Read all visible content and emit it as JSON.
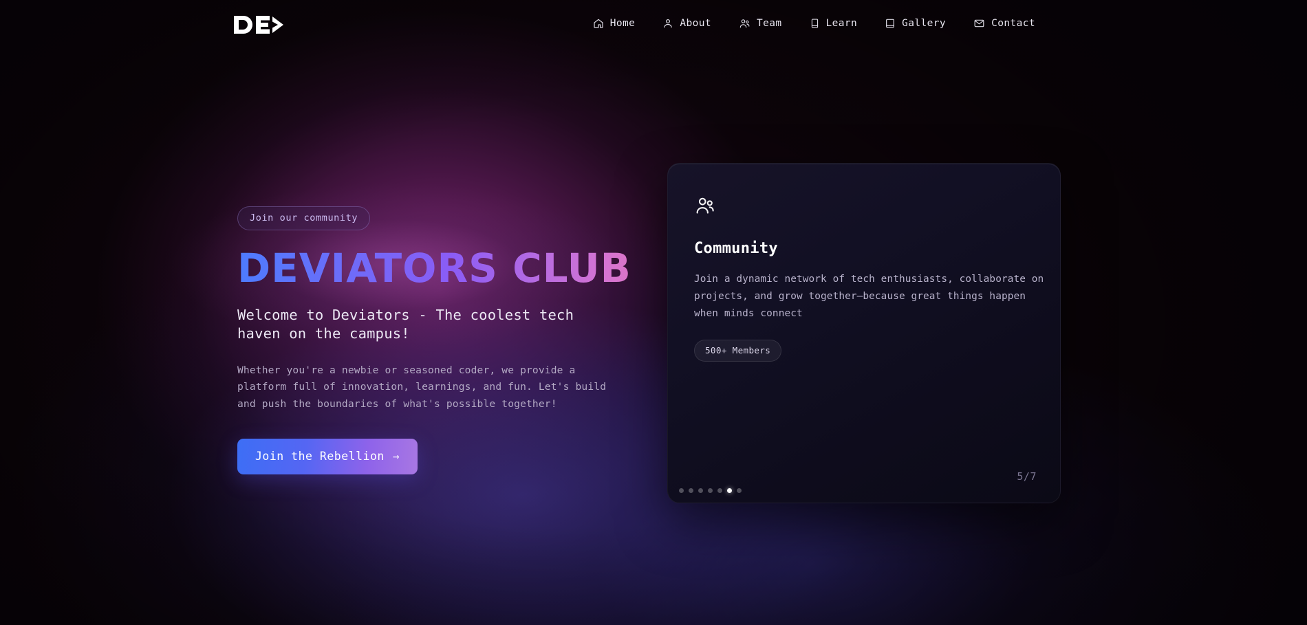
{
  "brand": {
    "logo_text": "DE>",
    "logo_icon": "de-chevron-logo"
  },
  "nav": {
    "items": [
      {
        "label": "Home",
        "icon": "home-icon"
      },
      {
        "label": "About",
        "icon": "user-icon"
      },
      {
        "label": "Team",
        "icon": "users-icon"
      },
      {
        "label": "Learn",
        "icon": "book-icon"
      },
      {
        "label": "Gallery",
        "icon": "image-frame-icon"
      },
      {
        "label": "Contact",
        "icon": "mail-icon"
      }
    ]
  },
  "hero": {
    "badge": "Join our community",
    "title": "DEVIATORS CLUB",
    "subtitle": "Welcome to Deviators - The coolest tech haven on the campus!",
    "description": "Whether you're a newbie or seasoned coder, we provide a platform full of innovation, learnings, and fun. Let's build and push the boundaries of what's possible together!",
    "cta_label": "Join the Rebellion",
    "cta_arrow": "→"
  },
  "card": {
    "icon": "users-icon",
    "title": "Community",
    "description": "Join a dynamic network of tech enthusiasts, collaborate on projects, and grow together—because great things happen when minds connect",
    "badge": "500+ Members",
    "counter": "5/7",
    "dots_total": 7,
    "dots_active_index": 5
  },
  "colors": {
    "accent_blue": "#4d7cfe",
    "accent_purple": "#8b5cf6",
    "accent_pink": "#e879c8",
    "card_bg": "#131124",
    "page_bg": "#0c0409",
    "text_primary": "#ffffff",
    "text_muted": "#b3a9c4"
  }
}
